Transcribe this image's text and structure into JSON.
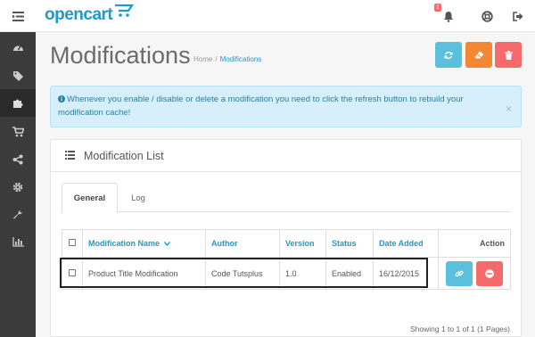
{
  "header": {
    "logo_text": "opencart",
    "notification_count": "1",
    "icons": [
      "menu-bars-icon",
      "bell-icon",
      "lifebuoy-icon",
      "sign-out-icon"
    ]
  },
  "sidebar": {
    "items": [
      {
        "icon": "dashboard-icon"
      },
      {
        "icon": "tags-icon"
      },
      {
        "icon": "puzzle-piece-icon",
        "active": true
      },
      {
        "icon": "shopping-cart-icon"
      },
      {
        "icon": "share-icon"
      },
      {
        "icon": "gear-icon"
      },
      {
        "icon": "wrench-icon"
      },
      {
        "icon": "bar-chart-icon"
      }
    ]
  },
  "page": {
    "title": "Modifications",
    "breadcrumb": [
      "Home",
      "Modifications"
    ],
    "buttons": {
      "refresh": {
        "icon": "refresh-icon",
        "color": "#5bc0de"
      },
      "clear": {
        "icon": "eraser-icon",
        "color": "#f38733"
      },
      "delete": {
        "icon": "trash-icon",
        "color": "#f56b6b"
      }
    }
  },
  "alert": {
    "icon": "info-circle-icon",
    "text": "Whenever you enable / disable or delete a modification you need to click the refresh button to rebuild your modification cache!",
    "close": "×"
  },
  "panel": {
    "title": "Modification List",
    "tabs": [
      "General",
      "Log"
    ],
    "active_tab": "General",
    "columns": {
      "name": "Modification Name",
      "author": "Author",
      "version": "Version",
      "status": "Status",
      "date_added": "Date Added",
      "action": "Action"
    },
    "sort_indicator": "chevron-down-icon",
    "rows": [
      {
        "name": "Product Title Modification",
        "author": "Code Tutsplus",
        "version": "1.0",
        "status": "Enabled",
        "date_added": "16/12/2015"
      }
    ],
    "pagination_text": "Showing 1 to 1 of 1 (1 Pages)"
  },
  "colors": {
    "accent": "#229ac8",
    "info": "#5bc0de",
    "warning": "#f38733",
    "danger": "#f56b6b",
    "sidebar": "#3b3b3b"
  }
}
